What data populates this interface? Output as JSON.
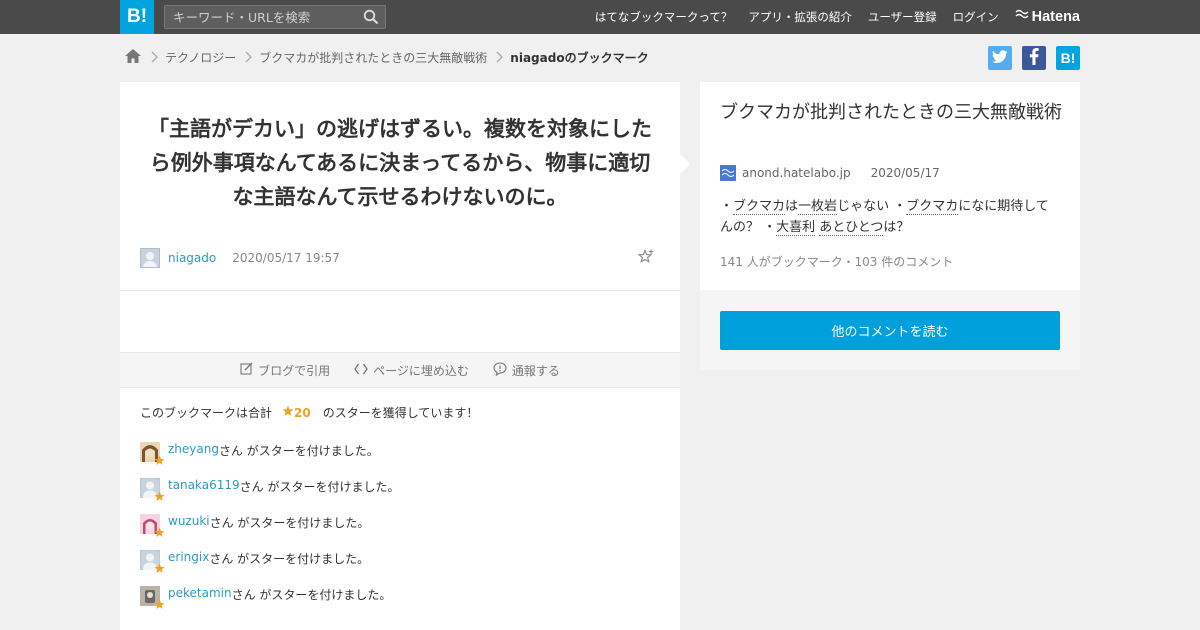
{
  "topbar": {
    "logo": "B!",
    "search_placeholder": "キーワード・URLを検索",
    "nav": [
      "はてなブックマークって？",
      "アプリ・拡張の紹介",
      "ユーザー登録",
      "ログイン"
    ],
    "brand": "Hatena"
  },
  "breadcrumb": {
    "items": [
      "テクノロジー",
      "ブクマカが批判されたときの三大無敵戦術"
    ],
    "current": "niagadoのブックマーク"
  },
  "share": {
    "twitter_color": "#55acee",
    "facebook_color": "#3b5998",
    "hatena_color": "#00a4de",
    "hatena_label": "B!"
  },
  "bookmark": {
    "comment": "「主語がデカい」の逃げはずるい。複数を対象にしたら例外事項なんてあるに決まってるから、物事に適切な主語なんて示せるわけないのに。",
    "user": "niagado",
    "datetime": "2020/05/17 19:57"
  },
  "actions": {
    "blog_cite": "ブログで引用",
    "embed": "ページに埋め込む",
    "report": "通報する"
  },
  "stars": {
    "summary_prefix": "このブックマークは合計",
    "count": "20",
    "summary_suffix": "のスターを獲得しています！",
    "suffix_text": "さん がスターを付けました。",
    "users": [
      {
        "name": "zheyang",
        "avatar": "brown-hair"
      },
      {
        "name": "tanaka6119",
        "avatar": "default"
      },
      {
        "name": "wuzuki",
        "avatar": "pink"
      },
      {
        "name": "eringix",
        "avatar": "default"
      },
      {
        "name": "peketamin",
        "avatar": "gray"
      }
    ]
  },
  "entry": {
    "title": "ブクマカが批判されたときの三大無敵戦術",
    "domain": "anond.hatelabo.jp",
    "date": "2020/05/17",
    "desc": {
      "p1": "・",
      "k1": "ブクマカ",
      "p2": "は",
      "k2": "一枚岩",
      "p3": "じゃない ・",
      "k3": "ブクマカ",
      "p4": "になに期待してんの？ ・",
      "k4": "大喜利",
      "p5": " ",
      "k5": "あとひとつ",
      "p6": "は？"
    },
    "stats": "141 人がブックマーク・103 件のコメント",
    "more_button": "他のコメントを読む"
  }
}
